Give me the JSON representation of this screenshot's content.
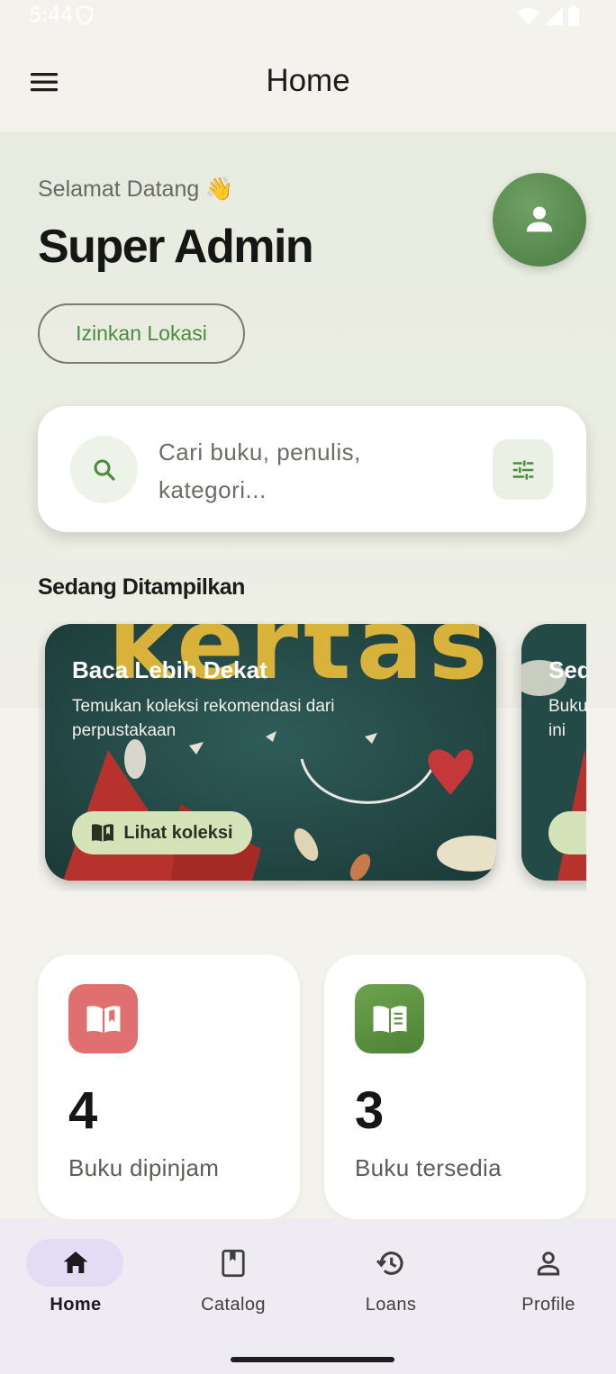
{
  "status_bar": {
    "time": "5:44"
  },
  "app_bar": {
    "title": "Home"
  },
  "header": {
    "greeting": "Selamat Datang 👋",
    "user_name": "Super Admin",
    "location_button": "Izinkan Lokasi"
  },
  "search": {
    "placeholder": "Cari buku, penulis, kategori..."
  },
  "featured": {
    "section_title": "Sedang Ditampilkan",
    "banners": [
      {
        "title": "Baca Lebih Dekat",
        "subtitle": "Temukan koleksi rekomendasi dari perpustakaan",
        "button_label": "Lihat koleksi",
        "art_text": "kertas"
      },
      {
        "title": "Sed",
        "subtitle": "Buku ini",
        "button_label": ""
      }
    ]
  },
  "stats": [
    {
      "value": "4",
      "label": "Buku dipinjam",
      "icon": "open-book-icon",
      "color": "#e07070"
    },
    {
      "value": "3",
      "label": "Buku tersedia",
      "icon": "book-lines-icon",
      "color": "#5d9042"
    }
  ],
  "bottom_nav": {
    "items": [
      {
        "label": "Home",
        "icon": "home-icon",
        "active": true
      },
      {
        "label": "Catalog",
        "icon": "bookmark-book-icon",
        "active": false
      },
      {
        "label": "Loans",
        "icon": "history-icon",
        "active": false
      },
      {
        "label": "Profile",
        "icon": "person-icon",
        "active": false
      }
    ]
  },
  "colors": {
    "accent_green": "#4d8a3f",
    "nav_bg": "#efebf3",
    "nav_active": "#e4dcf5",
    "background": "#f4f2ec"
  }
}
